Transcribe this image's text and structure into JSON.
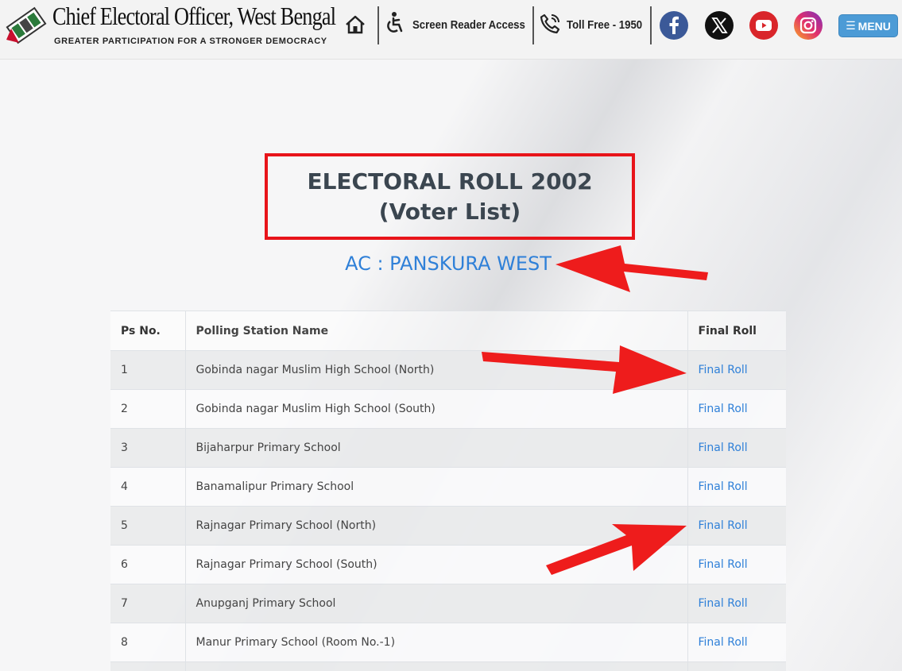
{
  "header": {
    "site_title": "Chief Electoral Officer, West Bengal",
    "tagline": "GREATER PARTICIPATION FOR A STRONGER DEMOCRACY",
    "screen_reader_label": "Screen Reader Access",
    "toll_free_label": "Toll Free - 1950",
    "menu_label": "MENU",
    "social": [
      "facebook-icon",
      "x-icon",
      "youtube-icon",
      "instagram-icon"
    ]
  },
  "main": {
    "title_line1": "ELECTORAL ROLL 2002",
    "title_line2": "(Voter List)",
    "ac_title": "AC : PANSKURA WEST"
  },
  "table": {
    "headers": [
      "Ps No.",
      "Polling Station Name",
      "Final Roll"
    ],
    "rows": [
      {
        "no": "1",
        "name": "Gobinda nagar Muslim High School (North)",
        "link": "Final Roll"
      },
      {
        "no": "2",
        "name": "Gobinda nagar Muslim High School (South)",
        "link": "Final Roll"
      },
      {
        "no": "3",
        "name": "Bijaharpur Primary School",
        "link": "Final Roll"
      },
      {
        "no": "4",
        "name": "Banamalipur Primary School",
        "link": "Final Roll"
      },
      {
        "no": "5",
        "name": "Rajnagar Primary School (North)",
        "link": "Final Roll"
      },
      {
        "no": "6",
        "name": "Rajnagar Primary School (South)",
        "link": "Final Roll"
      },
      {
        "no": "7",
        "name": "Anupganj Primary School",
        "link": "Final Roll"
      },
      {
        "no": "8",
        "name": "Manur Primary School (Room No.-1)",
        "link": "Final Roll"
      }
    ]
  },
  "colors": {
    "accent_blue": "#2f80d8",
    "annotation_red": "#e8141a",
    "menu_blue": "#4c9bd6"
  }
}
